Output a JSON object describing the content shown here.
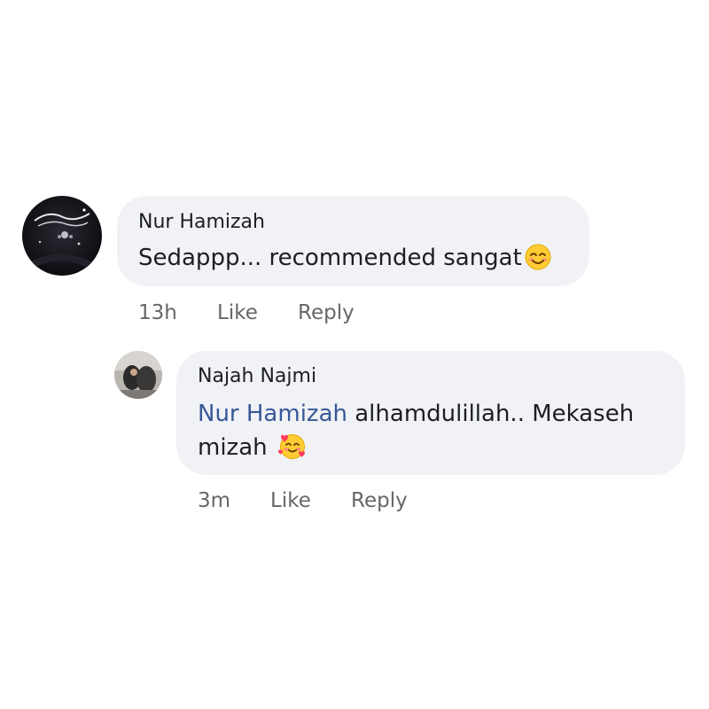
{
  "comments": [
    {
      "author": "Nur Hamizah",
      "text": "Sedappp... recommended sangat",
      "emoji": "smiling-face-with-smiling-eyes",
      "time": "13h",
      "like_label": "Like",
      "reply_label": "Reply"
    },
    {
      "author": "Najah Najmi",
      "mention": "Nur Hamizah",
      "text_line1": " alhamdulillah.. Mekaseh",
      "text_line2": "mizah ",
      "emoji": "smiling-face-with-hearts",
      "time": "3m",
      "like_label": "Like",
      "reply_label": "Reply"
    }
  ],
  "colors": {
    "bubble": "#f0f2f5",
    "mention": "#385898",
    "meta": "#65676b",
    "text": "#1c1e21"
  }
}
